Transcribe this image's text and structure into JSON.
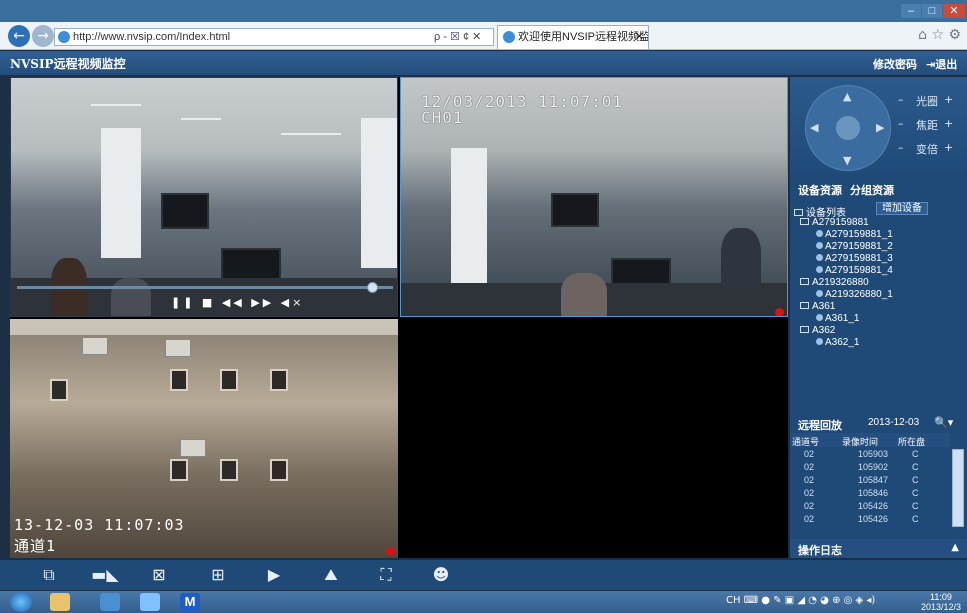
{
  "browser": {
    "address": "http://www.nvsip.com/Index.html",
    "address_tools": "ρ - ☒ ¢ ✕",
    "tab_title": "欢迎使用NVSIP远程视频监...",
    "tab_close": "✕",
    "back": "←",
    "forward": "→",
    "win_min": "–",
    "win_max": "□",
    "win_close": "✕",
    "right_icons": "⌂ ☆ ⚙"
  },
  "header": {
    "title": "NVSIP远程视频监控",
    "change_password": "修改密码",
    "logout": "⇥退出"
  },
  "cameras": {
    "cam2_time": "12/03/2013 11:07:01",
    "cam2_channel": "CH01",
    "cam3_time": "13-12-03 11:07:03",
    "cam3_channel": "通道1",
    "player_buttons": "❚❚ ■ ◀◀ ▶▶ ◀×"
  },
  "ptz": {
    "minus": "–",
    "plus": "+",
    "iris": "光圈",
    "focus": "焦距",
    "zoom": "变倍"
  },
  "resources": {
    "tab_device": "设备资源",
    "tab_group": "分组资源",
    "device_list": "设备列表",
    "add_device": "增加设备",
    "tree": [
      {
        "label": "A279159881",
        "level": 0
      },
      {
        "label": "A279159881_1",
        "level": 1
      },
      {
        "label": "A279159881_2",
        "level": 1
      },
      {
        "label": "A279159881_3",
        "level": 1
      },
      {
        "label": "A279159881_4",
        "level": 1
      },
      {
        "label": "A219326880",
        "level": 0
      },
      {
        "label": "A219326880_1",
        "level": 1
      },
      {
        "label": "A361",
        "level": 0
      },
      {
        "label": "A361_1",
        "level": 1
      },
      {
        "label": "A362",
        "level": 0
      },
      {
        "label": "A362_1",
        "level": 1
      }
    ]
  },
  "playback": {
    "title": "远程回放",
    "date": "2013-12-03",
    "search_icon": "search-icon",
    "headers": [
      "通道号",
      "录像时间",
      "所在盘"
    ],
    "rows": [
      [
        "02",
        "105903",
        "C"
      ],
      [
        "02",
        "105902",
        "C"
      ],
      [
        "02",
        "105847",
        "C"
      ],
      [
        "02",
        "105846",
        "C"
      ],
      [
        "02",
        "105426",
        "C"
      ],
      [
        "02",
        "105426",
        "C"
      ]
    ]
  },
  "oplog": {
    "title": "操作日志",
    "toggle": "▲"
  },
  "taskbar": {
    "time": "11:09",
    "date": "2013/12/3",
    "tray_lang": "CH"
  }
}
